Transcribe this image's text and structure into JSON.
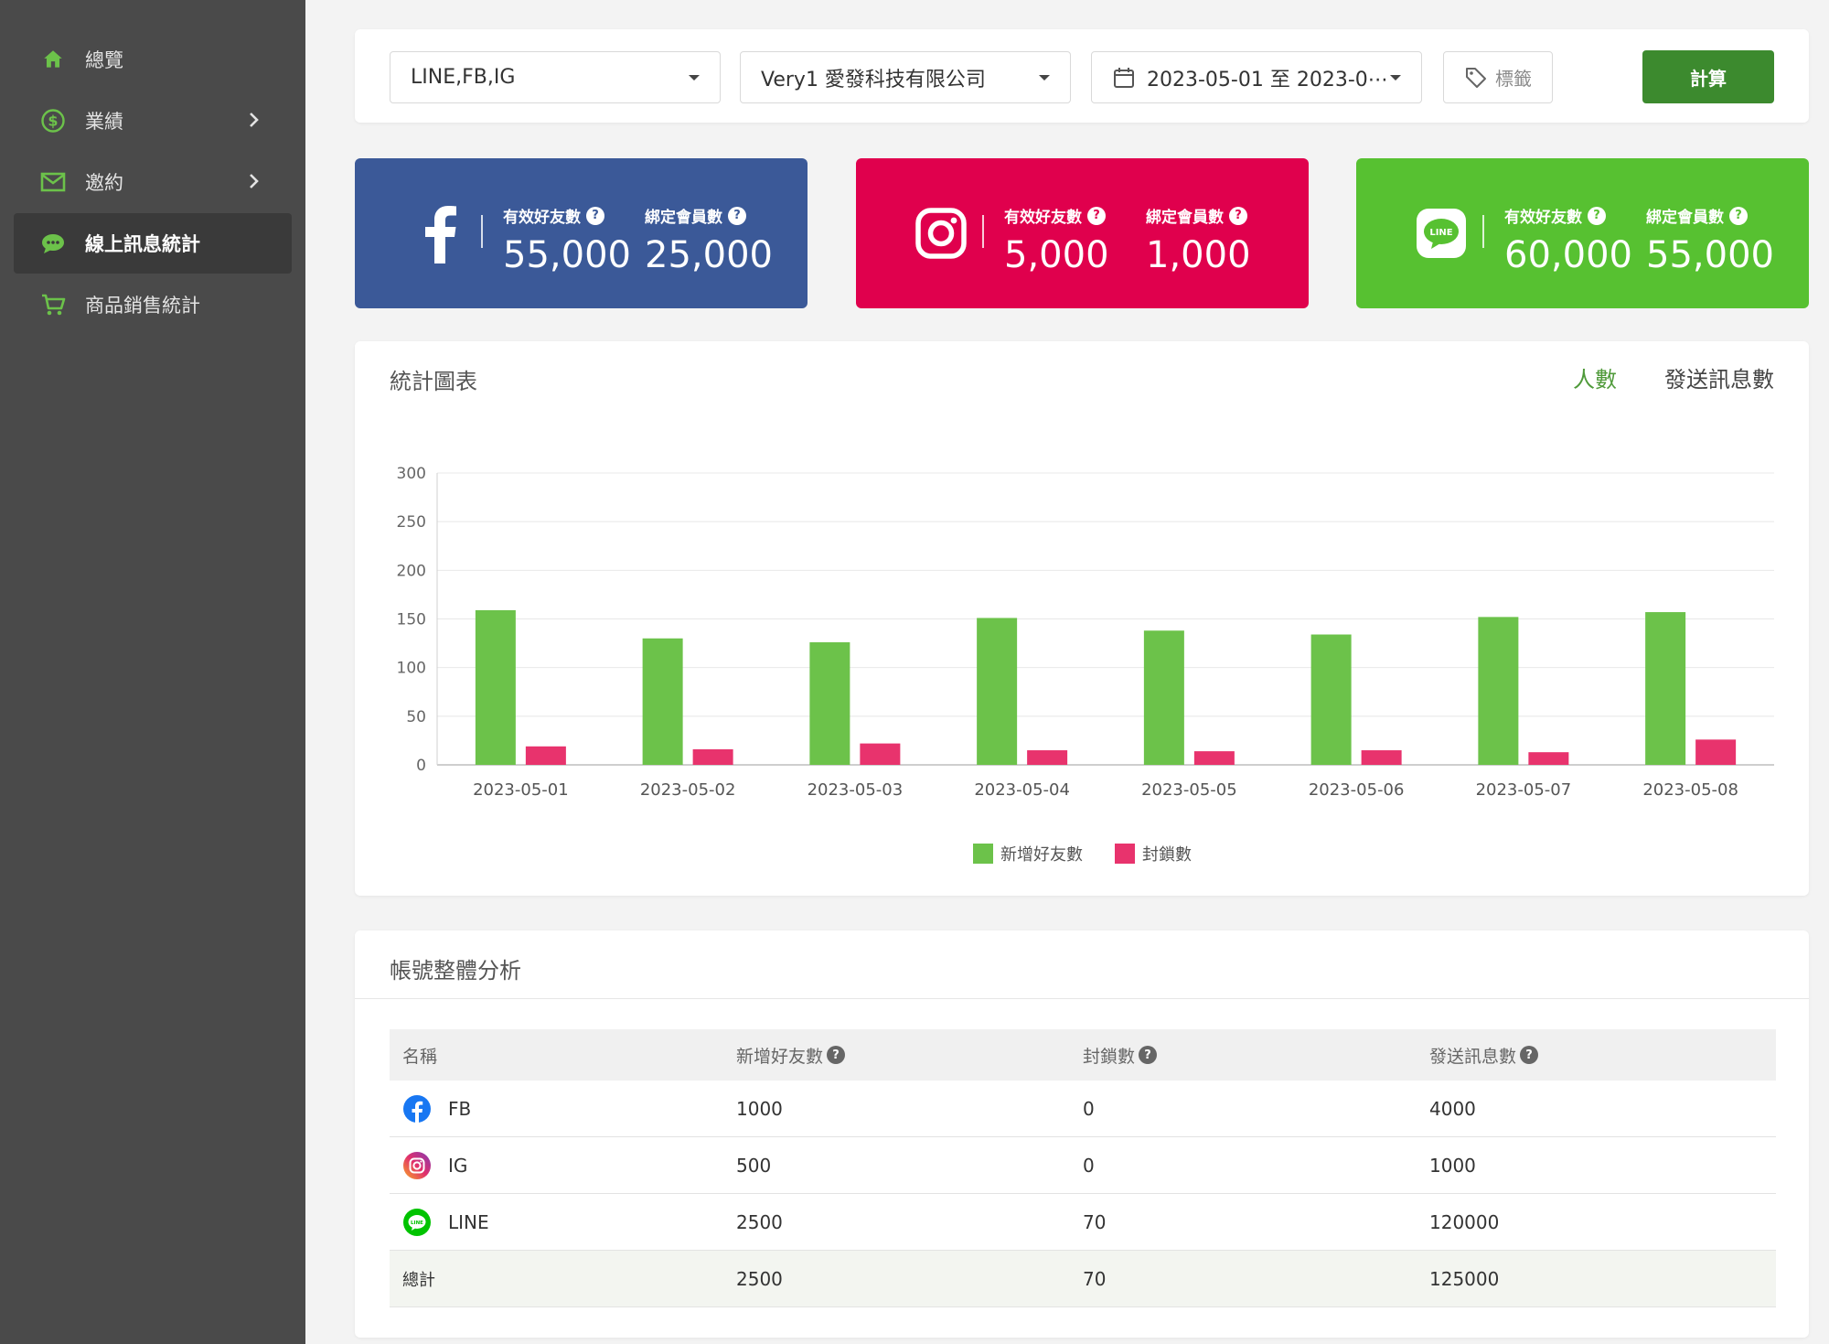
{
  "sidebar": {
    "items": [
      {
        "label": "總覽",
        "icon": "home-icon",
        "has_chevron": false,
        "active": false
      },
      {
        "label": "業績",
        "icon": "dollar-icon",
        "has_chevron": true,
        "active": false
      },
      {
        "label": "邀約",
        "icon": "mail-icon",
        "has_chevron": true,
        "active": false
      },
      {
        "label": "線上訊息統計",
        "icon": "chat-icon",
        "has_chevron": false,
        "active": true
      },
      {
        "label": "商品銷售統計",
        "icon": "cart-icon",
        "has_chevron": false,
        "active": false
      }
    ]
  },
  "filters": {
    "channels": "LINE,FB,IG",
    "company": "Very1 愛發科技有限公司",
    "date_range": "2023-05-01 至 2023-0⋯",
    "tag_label": "標籤",
    "calc_label": "計算"
  },
  "cards": {
    "fb": {
      "label1": "有效好友數",
      "value1": "55,000",
      "label2": "綁定會員數",
      "value2": "25,000",
      "color": "#3b5998"
    },
    "ig": {
      "label1": "有效好友數",
      "value1": "5,000",
      "label2": "綁定會員數",
      "value2": "1,000",
      "color": "#e0004d"
    },
    "line": {
      "label1": "有效好友數",
      "value1": "60,000",
      "label2": "綁定會員數",
      "value2": "55,000",
      "color": "#57c131"
    }
  },
  "chart_section": {
    "title": "統計圖表",
    "toggle_people": "人數",
    "toggle_messages": "發送訊息數"
  },
  "chart_data": {
    "type": "bar",
    "categories": [
      "2023-05-01",
      "2023-05-02",
      "2023-05-03",
      "2023-05-04",
      "2023-05-05",
      "2023-05-06",
      "2023-05-07",
      "2023-05-08"
    ],
    "series": [
      {
        "name": "新增好友數",
        "values": [
          159,
          130,
          126,
          151,
          138,
          134,
          152,
          157
        ],
        "color": "#6cc24a"
      },
      {
        "name": "封鎖數",
        "values": [
          19,
          16,
          22,
          15,
          14,
          15,
          13,
          26
        ],
        "color": "#e8336d"
      }
    ],
    "yticks": [
      0,
      50,
      100,
      150,
      200,
      250,
      300
    ],
    "ylim": [
      0,
      300
    ],
    "grid": true,
    "legend": "bottom"
  },
  "table": {
    "title": "帳號整體分析",
    "headers": [
      "名稱",
      "新增好友數",
      "封鎖數",
      "發送訊息數"
    ],
    "rows": [
      {
        "name": "FB",
        "icon": "facebook-icon",
        "new": "1000",
        "blocked": "0",
        "sent": "4000"
      },
      {
        "name": "IG",
        "icon": "instagram-icon",
        "new": "500",
        "blocked": "0",
        "sent": "1000"
      },
      {
        "name": "LINE",
        "icon": "line-icon",
        "new": "2500",
        "blocked": "70",
        "sent": "120000"
      }
    ],
    "total": {
      "name": "總計",
      "new": "2500",
      "blocked": "70",
      "sent": "125000"
    }
  },
  "colors": {
    "accent_green": "#6cc24a",
    "button_green": "#3c8a2e",
    "sidebar_bg": "#4a4a4a"
  }
}
